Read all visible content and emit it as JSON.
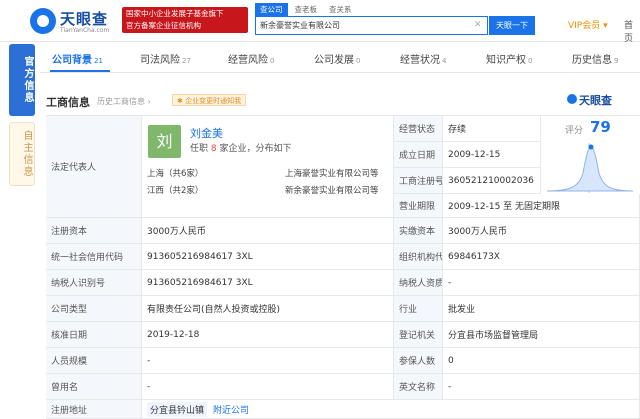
{
  "header": {
    "logo_title": "天眼查",
    "logo_sub": "TianYanCha.com",
    "banner_line1": "国家中小企业发展子基金旗下",
    "banner_line2": "官方备案企业征信机构",
    "search_tabs": [
      "查公司",
      "查老板",
      "查关系"
    ],
    "search_value": "新余豪誉实业有限公司",
    "search_button": "天眼一下",
    "vip": "VIP会员 ▾",
    "home": "首页"
  },
  "side_tabs": {
    "official": "官方信息",
    "self": "自主信息"
  },
  "nav": [
    {
      "label": "公司背景",
      "count": "21"
    },
    {
      "label": "司法风险",
      "count": "27"
    },
    {
      "label": "经营风险",
      "count": "0"
    },
    {
      "label": "公司发展",
      "count": "0"
    },
    {
      "label": "经营状况",
      "count": "4"
    },
    {
      "label": "知识产权",
      "count": "0"
    },
    {
      "label": "历史信息",
      "count": "9"
    }
  ],
  "section": {
    "title": "工商信息",
    "history": "历史工商信息 ›",
    "badge": "✱ 企业变更时通知我",
    "brand": "天眼查"
  },
  "rep": {
    "label": "法定代表人",
    "avatar": "刘",
    "name": "刘金美",
    "role_prefix": "任职",
    "role_count": "8",
    "role_suffix": "家企业，分布如下",
    "regions": [
      {
        "region": "上海（共6家）",
        "company": "上海豪誉实业有限公司等"
      },
      {
        "region": "江西（共2家）",
        "company": "新余豪誉实业有限公司等"
      }
    ]
  },
  "score": {
    "label": "评分",
    "value": "79"
  },
  "fields": {
    "status_label": "经营状态",
    "status": "存续",
    "established_label": "成立日期",
    "established": "2009-12-15",
    "regno_label": "工商注册号",
    "regno": "360521210002036",
    "term_label": "营业期限",
    "term": "2009-12-15 至 无固定期限",
    "capital_label": "注册资本",
    "capital": "3000万人民币",
    "paid_label": "实缴资本",
    "paid": "3000万人民币",
    "credit_label": "统一社会信用代码",
    "credit": "913605216984617 3XL",
    "org_label": "组织机构代码",
    "org": "69846173X",
    "taxid_label": "纳税人识别号",
    "taxid": "913605216984617 3XL",
    "taxq_label": "纳税人资质",
    "taxq": "-",
    "type_label": "公司类型",
    "type": "有限责任公司(自然人投资或控股)",
    "industry_label": "行业",
    "industry": "批发业",
    "approve_label": "核准日期",
    "approve": "2019-12-18",
    "authority_label": "登记机关",
    "authority": "分宜县市场监督管理局",
    "staff_label": "人员规模",
    "staff": "-",
    "insured_label": "参保人数",
    "insured": "0",
    "former_label": "曾用名",
    "former": "-",
    "english_label": "英文名称",
    "english": "-",
    "address_label": "注册地址",
    "address": "分宜县钤山镇",
    "address_link": "附近公司"
  }
}
